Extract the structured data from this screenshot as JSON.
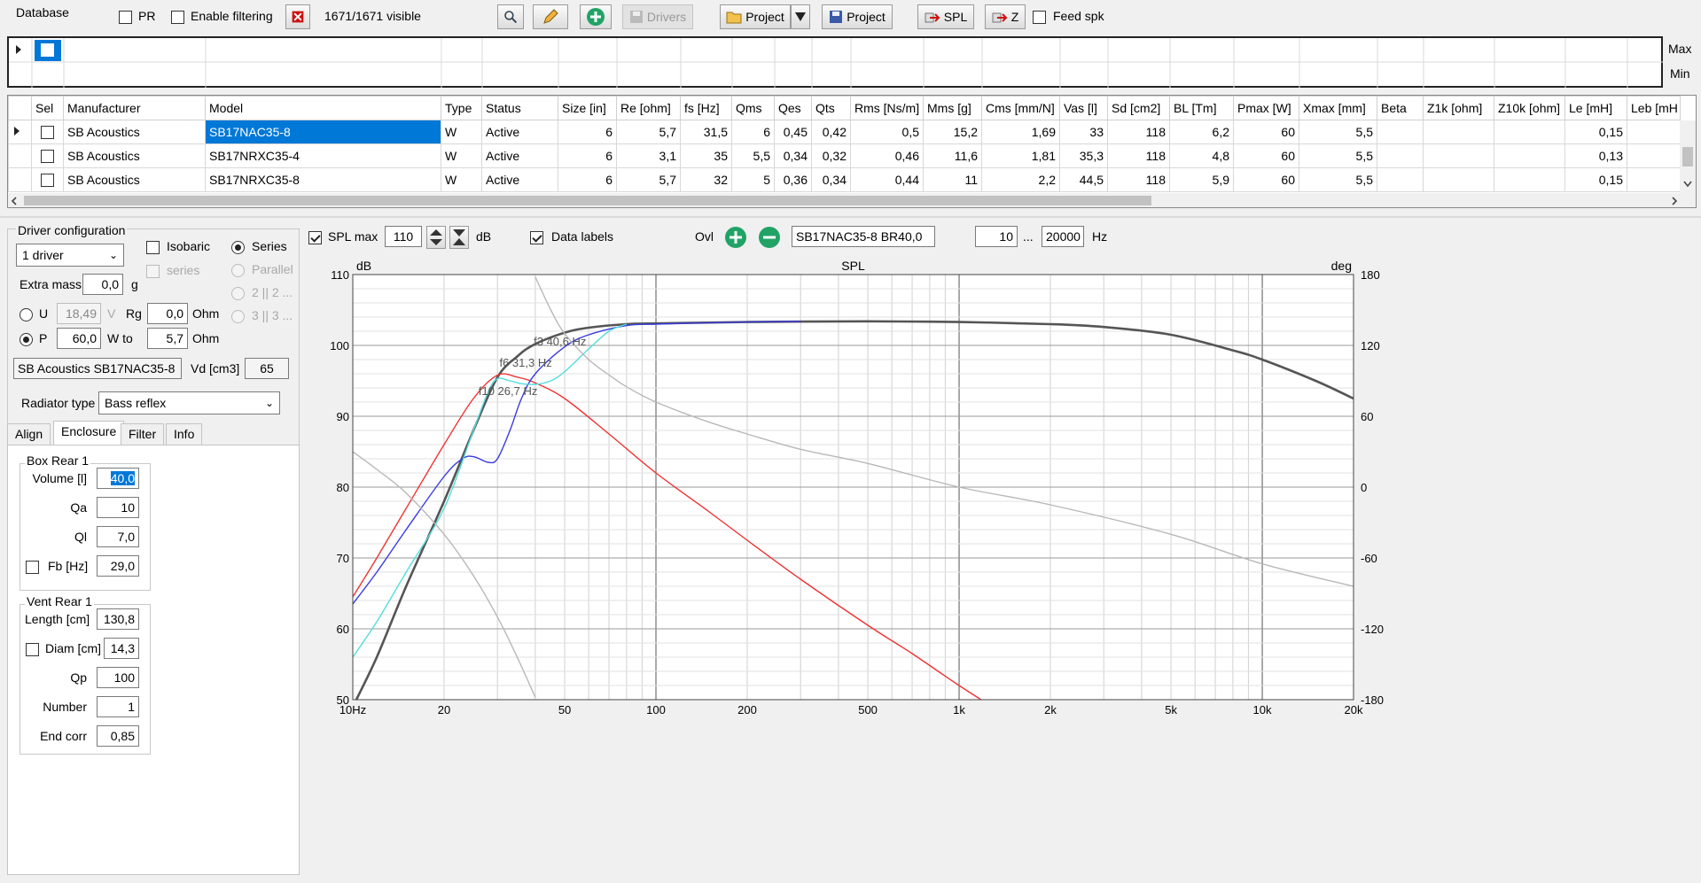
{
  "toolbar": {
    "database_label": "Database",
    "pr_label": "PR",
    "enable_filtering_label": "Enable filtering",
    "visible_count": "1671/1671 visible",
    "drivers_label": "Drivers",
    "project_label": "Project",
    "project2_label": "Project",
    "spl_label": "SPL",
    "z_label": "Z",
    "feed_spk_label": "Feed spk"
  },
  "filter": {
    "max_label": "Max",
    "min_label": "Min"
  },
  "table": {
    "headers": [
      "Sel",
      "Manufacturer",
      "Model",
      "Type",
      "Status",
      "Size [in]",
      "Re [ohm]",
      "fs [Hz]",
      "Qms",
      "Qes",
      "Qts",
      "Rms [Ns/m]",
      "Mms [g]",
      "Cms [mm/N]",
      "Vas [l]",
      "Sd [cm2]",
      "BL [Tm]",
      "Pmax [W]",
      "Xmax [mm]",
      "Beta",
      "Z1k [ohm]",
      "Z10k [ohm]",
      "Le [mH]",
      "Leb [mH"
    ],
    "rows": [
      [
        "",
        "SB Acoustics",
        "SB17NAC35-8",
        "W",
        "Active",
        "6",
        "5,7",
        "31,5",
        "6",
        "0,45",
        "0,42",
        "0,5",
        "15,2",
        "1,69",
        "33",
        "118",
        "6,2",
        "60",
        "5,5",
        "",
        "",
        "",
        "0,15",
        ""
      ],
      [
        "",
        "SB Acoustics",
        "SB17NRXC35-4",
        "W",
        "Active",
        "6",
        "3,1",
        "35",
        "5,5",
        "0,34",
        "0,32",
        "0,46",
        "11,6",
        "1,81",
        "35,3",
        "118",
        "4,8",
        "60",
        "5,5",
        "",
        "",
        "",
        "0,13",
        ""
      ],
      [
        "",
        "SB Acoustics",
        "SB17NRXC35-8",
        "W",
        "Active",
        "6",
        "5,7",
        "32",
        "5",
        "0,36",
        "0,34",
        "0,44",
        "11",
        "2,2",
        "44,5",
        "118",
        "5,9",
        "60",
        "5,5",
        "",
        "",
        "",
        "0,15",
        ""
      ]
    ]
  },
  "driver_config": {
    "title": "Driver configuration",
    "driver_count": "1 driver",
    "isobaric_label": "Isobaric",
    "series_opt_label": "series",
    "series_label": "Series",
    "parallel_label": "Parallel",
    "opt_2": "2 || 2 ...",
    "opt_3": "3 || 3 ...",
    "extra_mass_label": "Extra mass",
    "extra_mass_value": "0,0",
    "extra_mass_unit": "g",
    "u_label": "U",
    "u_value": "18,49",
    "u_unit": "V",
    "rg_label": "Rg",
    "rg_value": "0,0",
    "rg_unit": "Ohm",
    "p_label": "P",
    "p_value": "60,0",
    "p_unit": "W to",
    "to_value": "5,7",
    "to_unit": "Ohm",
    "driver_name": "SB Acoustics SB17NAC35-8",
    "vd_label": "Vd [cm3]",
    "vd_value": "65",
    "radiator_label": "Radiator type",
    "radiator_value": "Bass reflex"
  },
  "tabs": [
    "Align",
    "Enclosure",
    "Filter",
    "Info"
  ],
  "box": {
    "title": "Box Rear 1",
    "volume_label": "Volume [l]",
    "volume_value": "40,0",
    "qa_label": "Qa",
    "qa_value": "10",
    "ql_label": "Ql",
    "ql_value": "7,0",
    "fb_label": "Fb [Hz]",
    "fb_value": "29,0"
  },
  "vent": {
    "title": "Vent Rear 1",
    "length_label": "Length [cm]",
    "length_value": "130,8",
    "diam_label": "Diam [cm]",
    "diam_value": "14,3",
    "qp_label": "Qp",
    "qp_value": "100",
    "number_label": "Number",
    "number_value": "1",
    "endcorr_label": "End corr",
    "endcorr_value": "0,85"
  },
  "graph_toolbar": {
    "spl_max_label": "SPL max",
    "spl_max_value": "110",
    "db_label": "dB",
    "data_labels_label": "Data labels",
    "ovl_label": "Ovl",
    "overlay_name": "SB17NAC35-8 BR40,0",
    "f_from": "10",
    "ellipsis": "...",
    "f_to": "20000",
    "hz_label": "Hz"
  },
  "colors": {
    "selection": "#0078d7",
    "spl": "#555555",
    "red": "#ee3333",
    "blue": "#3a3ae0",
    "cyan": "#55dddd",
    "gray": "#b8b8b8"
  },
  "chart_data": {
    "type": "line",
    "title": "SPL",
    "ylabel": "dB",
    "y2label": "deg",
    "xscale": "log",
    "xlim": [
      10,
      20000
    ],
    "ylim": [
      50,
      110
    ],
    "y2lim": [
      -180,
      180
    ],
    "xticks": [
      10,
      20,
      50,
      100,
      200,
      500,
      1000,
      2000,
      5000,
      10000,
      20000
    ],
    "xticklabels": [
      "10Hz",
      "20",
      "50",
      "100",
      "200",
      "500",
      "1k",
      "2k",
      "5k",
      "10k",
      "20k"
    ],
    "yticks": [
      50,
      60,
      70,
      80,
      90,
      100,
      110
    ],
    "yticklabels": [
      "50",
      "60",
      "70",
      "80",
      "90",
      "100",
      "110"
    ],
    "y2ticks": [
      -180,
      -120,
      -60,
      0,
      60,
      120,
      180
    ],
    "y2ticklabels": [
      "-180",
      "-120",
      "-60",
      "0",
      "60",
      "120",
      "180"
    ],
    "grid": true,
    "annotations": [
      {
        "text": "f3 40,6 Hz",
        "x": 40.6,
        "y": 100
      },
      {
        "text": "f6 31,3 Hz",
        "x": 31.3,
        "y": 97
      },
      {
        "text": "f10 26,7 Hz",
        "x": 26.7,
        "y": 93
      }
    ],
    "series": [
      {
        "color": "#555555",
        "axis": "y",
        "x": [
          10,
          12,
          15,
          20,
          25,
          30,
          35,
          40,
          50,
          60,
          80,
          100,
          200,
          500,
          1000,
          2000,
          3000,
          5000,
          8000,
          10000,
          15000,
          20000
        ],
        "y": [
          49,
          56,
          66,
          78,
          88,
          95.5,
          98.5,
          100.2,
          101.8,
          102.5,
          103,
          103.1,
          103.3,
          103.4,
          103.3,
          103,
          102.6,
          101.5,
          99.3,
          98,
          95,
          92.5
        ]
      },
      {
        "color": "#ee3333",
        "axis": "y",
        "x": [
          10,
          12,
          15,
          20,
          25,
          30,
          35,
          40,
          50,
          70,
          100,
          150,
          200,
          300,
          500,
          700,
          1000,
          1400
        ],
        "y": [
          64.5,
          70,
          77,
          86,
          92.5,
          95.8,
          95.5,
          94.7,
          92.5,
          87.5,
          82,
          76.5,
          72.5,
          67,
          60.5,
          56.5,
          52,
          48
        ]
      },
      {
        "color": "#3a3ae0",
        "axis": "y",
        "x": [
          10,
          12,
          15,
          20,
          23,
          25,
          28,
          30,
          33,
          36,
          40,
          50,
          60,
          80,
          100,
          150,
          200,
          300
        ],
        "y": [
          63.5,
          68,
          74,
          81.5,
          84,
          84.3,
          83.5,
          84,
          88,
          92.5,
          96,
          99.8,
          101.5,
          102.8,
          103,
          103.2,
          103.3,
          103.4
        ]
      },
      {
        "color": "#55dddd",
        "axis": "y",
        "x": [
          10,
          12,
          15,
          20,
          25,
          28,
          30,
          33,
          36,
          40,
          45,
          50,
          60,
          70,
          80
        ],
        "y": [
          56,
          61,
          68,
          77,
          88,
          93.5,
          95.3,
          95,
          94.6,
          94.5,
          95,
          96.3,
          99.5,
          102,
          103
        ]
      },
      {
        "color": "#b8b8b8",
        "axis": "y2",
        "x": [
          10,
          12,
          15,
          20,
          25,
          30,
          35,
          40
        ],
        "y": [
          30,
          15,
          -5,
          -40,
          -75,
          -110,
          -145,
          -178
        ]
      },
      {
        "color": "#b8b8b8",
        "axis": "y2",
        "x": [
          40,
          45,
          50,
          60,
          70,
          80,
          100,
          150,
          200,
          300,
          500,
          1000,
          2000,
          5000,
          10000,
          20000
        ],
        "y": [
          178,
          150,
          130,
          108,
          95,
          85,
          72,
          55,
          45,
          32,
          20,
          0,
          -15,
          -40,
          -65,
          -84
        ]
      }
    ]
  }
}
